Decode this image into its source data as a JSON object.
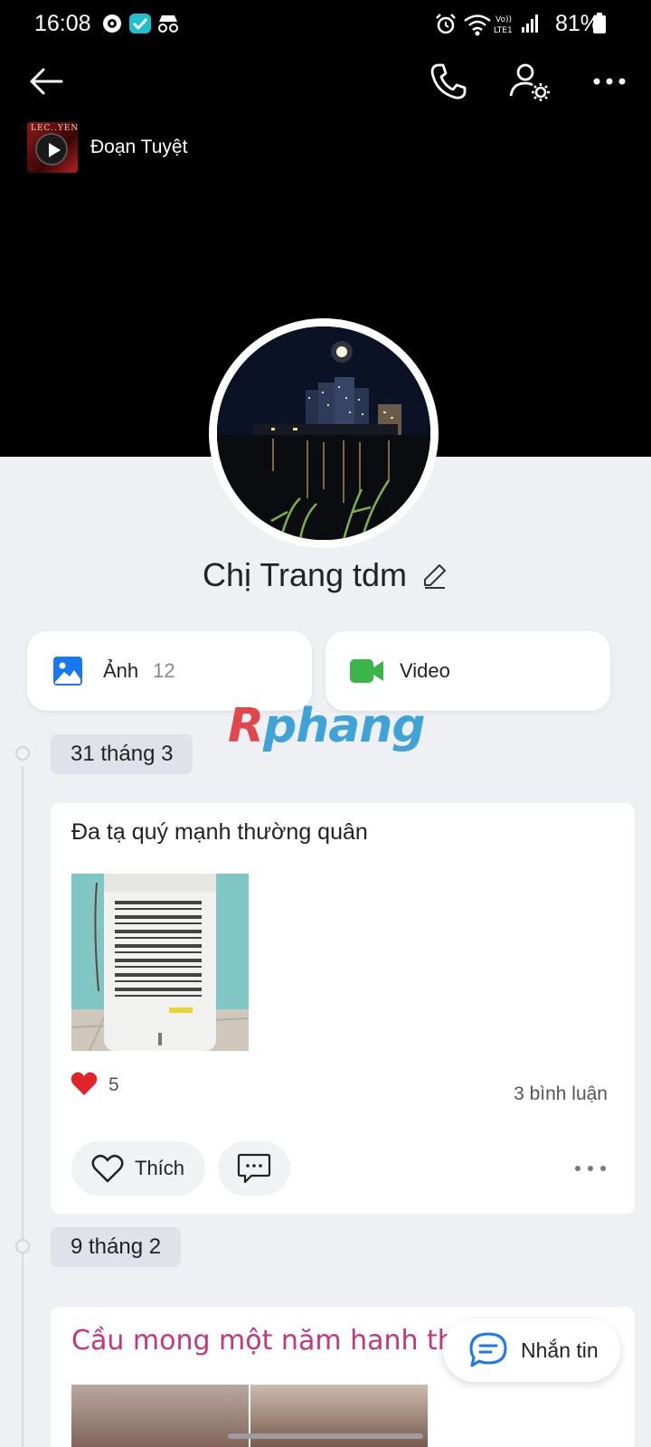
{
  "status_bar": {
    "time": "16:08",
    "battery": "81%"
  },
  "music": {
    "title": "Đoạn Tuyệt",
    "cover_text": "LEC..YEN"
  },
  "profile": {
    "name": "Chị Trang tdm"
  },
  "media": {
    "photos_label": "Ảnh",
    "photos_count": "12",
    "video_label": "Video"
  },
  "watermark": {
    "r": "R",
    "rest": "phang"
  },
  "posts": [
    {
      "date": "31 tháng 3",
      "text": "Đa tạ quý mạnh thường quân",
      "reactions": "5",
      "comments": "3 bình luận",
      "like_label": "Thích"
    },
    {
      "date": "9 tháng 2",
      "text": "Cầu mong một năm hanh thông"
    }
  ],
  "chat": {
    "label": "Nhắn tin"
  },
  "colors": {
    "accent": "#1877f2",
    "video": "#3bb54a",
    "heart": "#e0242a",
    "pink_text": "#c8357a"
  }
}
